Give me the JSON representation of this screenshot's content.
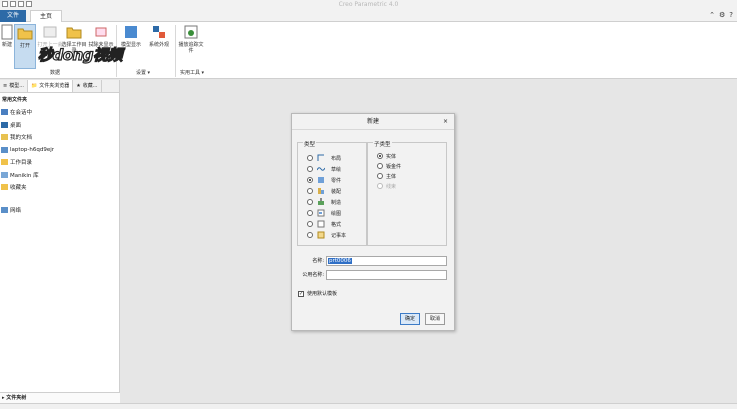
{
  "app": {
    "title": "Creo Parametric 4.0"
  },
  "tabs": {
    "file": "文件",
    "home": "主页"
  },
  "ribbon": {
    "buttons": [
      {
        "key": "new",
        "label": "新建",
        "enabled": true
      },
      {
        "key": "open",
        "label": "打开",
        "enabled": true,
        "active": true
      },
      {
        "key": "open-last",
        "label": "打开上一会话",
        "enabled": false
      },
      {
        "key": "select-workdir",
        "label": "选择工作目录",
        "enabled": true
      },
      {
        "key": "erase-undisplayed",
        "label": "拭除未显示的",
        "enabled": true
      },
      {
        "key": "model-display",
        "label": "模型显示",
        "enabled": true
      },
      {
        "key": "system-appearance",
        "label": "系统外观",
        "enabled": true
      },
      {
        "key": "playback-trail",
        "label": "播放追踪文件",
        "enabled": true
      }
    ],
    "groups": {
      "data": "数据",
      "settings": "设置 ▾",
      "utilities": "实用工具 ▾"
    },
    "watermark": "秒dong视频"
  },
  "navigator": {
    "tabs": [
      "模型...",
      "文件夹浏览器",
      "收藏..."
    ],
    "section_title": "常用文件夹",
    "items": [
      {
        "icon": "session-icon",
        "label": "在会话中"
      },
      {
        "icon": "desktop-icon",
        "label": "桌面"
      },
      {
        "icon": "documents-icon",
        "label": "我的文档"
      },
      {
        "icon": "computer-icon",
        "label": "laptop-h6qd9ejr"
      },
      {
        "icon": "workdir-icon",
        "label": "工作目录"
      },
      {
        "icon": "library-icon",
        "label": "Manikin 库"
      },
      {
        "icon": "favorites-icon",
        "label": "收藏夹"
      }
    ],
    "network": "网络",
    "bottom": "文件夹树"
  },
  "dialog": {
    "title": "新建",
    "type_legend": "类型",
    "subtype_legend": "子类型",
    "types": [
      {
        "label": "布局",
        "icon": "layout-icon",
        "checked": false
      },
      {
        "label": "草绘",
        "icon": "sketch-icon",
        "checked": false
      },
      {
        "label": "零件",
        "icon": "part-icon",
        "checked": true
      },
      {
        "label": "装配",
        "icon": "assembly-icon",
        "checked": false
      },
      {
        "label": "制造",
        "icon": "manufacturing-icon",
        "checked": false
      },
      {
        "label": "绘图",
        "icon": "drawing-icon",
        "checked": false
      },
      {
        "label": "格式",
        "icon": "format-icon",
        "checked": false
      },
      {
        "label": "记事本",
        "icon": "notebook-icon",
        "checked": false
      }
    ],
    "subtypes": [
      {
        "label": "实体",
        "checked": true,
        "enabled": true
      },
      {
        "label": "钣金件",
        "checked": false,
        "enabled": true
      },
      {
        "label": "主体",
        "checked": false,
        "enabled": true
      },
      {
        "label": "线束",
        "checked": false,
        "enabled": false
      }
    ],
    "name_label": "名称:",
    "name_value": "prt0006",
    "common_name_label": "公用名称:",
    "common_name_value": "",
    "use_default_template": "使用默认模板",
    "ok": "确定",
    "cancel": "取消"
  }
}
